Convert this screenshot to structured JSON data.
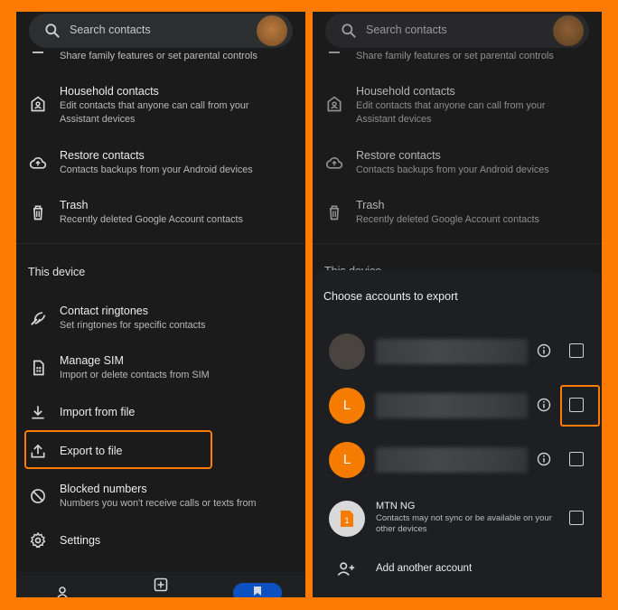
{
  "colors": {
    "frame": "#FF7A00",
    "panel": "#1b1b1b",
    "accent": "#FF7A00",
    "account_avatar": "#F57C00"
  },
  "left": {
    "search_placeholder": "Search contacts",
    "top_cut_text": "Share family features or set parental controls",
    "items_top": [
      {
        "title": "Household contacts",
        "subtitle": [
          "Edit contacts that anyone can call from your",
          "Assistant devices"
        ],
        "icon": "household-icon"
      },
      {
        "title": "Restore contacts",
        "subtitle": [
          "Contacts backups from your Android devices"
        ],
        "icon": "cloud-restore-icon"
      },
      {
        "title": "Trash",
        "subtitle": [
          "Recently deleted Google Account contacts"
        ],
        "icon": "trash-icon"
      }
    ],
    "section_title": "This device",
    "items_device": [
      {
        "title": "Contact ringtones",
        "subtitle": "Set ringtones for specific contacts",
        "icon": "ringtone-icon"
      },
      {
        "title": "Manage SIM",
        "subtitle": "Import or delete contacts from SIM",
        "icon": "sim-icon"
      },
      {
        "title": "Import from file",
        "subtitle": "",
        "icon": "download-icon"
      },
      {
        "title": "Export to file",
        "subtitle": "",
        "icon": "upload-icon"
      },
      {
        "title": "Blocked numbers",
        "subtitle": "Numbers you won't receive calls or texts from",
        "icon": "block-icon"
      },
      {
        "title": "Settings",
        "subtitle": "",
        "icon": "gear-icon"
      }
    ]
  },
  "right": {
    "search_placeholder": "Search contacts",
    "top_cut_text": "Share family features or set parental controls",
    "items_top": [
      {
        "title": "Household contacts",
        "subtitle": [
          "Edit contacts that anyone can call from your",
          "Assistant devices"
        ]
      },
      {
        "title": "Restore contacts",
        "subtitle": [
          "Contacts backups from your Android devices"
        ]
      },
      {
        "title": "Trash",
        "subtitle": [
          "Recently deleted Google Account contacts"
        ]
      }
    ],
    "section_title_cut": "This device",
    "sheet": {
      "title": "Choose accounts to export",
      "accounts": [
        {
          "avatar_letter": "",
          "type": "photo",
          "checked": false
        },
        {
          "avatar_letter": "L",
          "type": "letter",
          "checked": false
        },
        {
          "avatar_letter": "L",
          "type": "letter",
          "checked": false
        }
      ],
      "mtn": {
        "name": "MTN NG",
        "note": "Contacts may not sync or be available on your other devices",
        "checked": false
      },
      "add_account": "Add another account"
    }
  }
}
